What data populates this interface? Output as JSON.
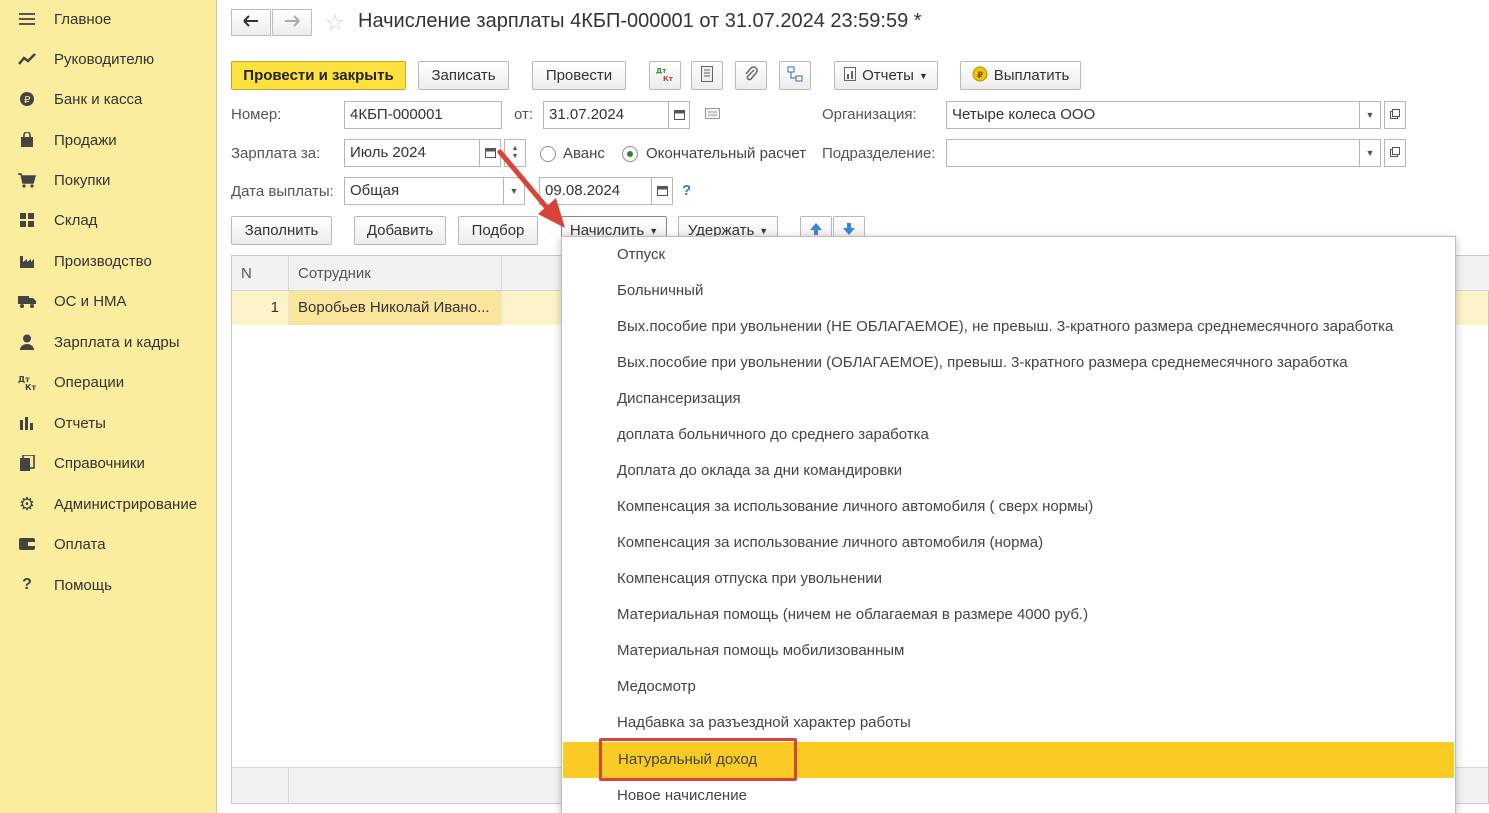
{
  "sidebar": {
    "items": [
      {
        "label": "Главное",
        "icon": "menu-icon"
      },
      {
        "label": "Руководителю",
        "icon": "trend-icon"
      },
      {
        "label": "Банк и касса",
        "icon": "coin-icon"
      },
      {
        "label": "Продажи",
        "icon": "bag-icon"
      },
      {
        "label": "Покупки",
        "icon": "cart-icon"
      },
      {
        "label": "Склад",
        "icon": "warehouse-icon"
      },
      {
        "label": "Производство",
        "icon": "factory-icon"
      },
      {
        "label": "ОС и НМА",
        "icon": "truck-icon"
      },
      {
        "label": "Зарплата и кадры",
        "icon": "person-icon"
      },
      {
        "label": "Операции",
        "icon": "dt-kt-icon"
      },
      {
        "label": "Отчеты",
        "icon": "bar-chart-icon"
      },
      {
        "label": "Справочники",
        "icon": "books-icon"
      },
      {
        "label": "Администрирование",
        "icon": "gear-icon"
      },
      {
        "label": "Оплата",
        "icon": "wallet-icon"
      },
      {
        "label": "Помощь",
        "icon": "question-icon"
      }
    ]
  },
  "header": {
    "title": "Начисление зарплаты 4КБП-000001 от 31.07.2024 23:59:59 *"
  },
  "toolbar": {
    "post_close": "Провести и закрыть",
    "save": "Записать",
    "post": "Провести",
    "dtkt_glyph": "Дт Кт",
    "reports": "Отчеты",
    "pay": "Выплатить"
  },
  "form": {
    "number_label": "Номер:",
    "number_value": "4КБП-000001",
    "from_label": "от:",
    "from_value": "31.07.2024",
    "org_label": "Организация:",
    "org_value": "Четыре колеса ООО",
    "salary_for_label": "Зарплата за:",
    "salary_for_value": "Июль 2024",
    "advance_label": "Аванс",
    "final_label": "Окончательный расчет",
    "dept_label": "Подразделение:",
    "dept_value": "",
    "pay_date_label": "Дата выплаты:",
    "pay_date_mode": "Общая",
    "pay_date_value": "09.08.2024",
    "help_mark": "?"
  },
  "table_toolbar": {
    "fill": "Заполнить",
    "add": "Добавить",
    "pick": "Подбор",
    "accrue": "Начислить",
    "withhold": "Удержать"
  },
  "table": {
    "columns": [
      "N",
      "Сотрудник"
    ],
    "rows": [
      {
        "n": "1",
        "employee": "Воробьев Николай Ивано..."
      }
    ]
  },
  "dropdown": {
    "items": [
      "Отпуск",
      "Больничный",
      "Вых.пособие при увольнении (НЕ ОБЛАГАЕМОЕ), не превыш. 3-кратного размера среднемесячного заработка",
      "Вых.пособие при увольнении (ОБЛАГАЕМОЕ), превыш. 3-кратного размера среднемесячного заработка",
      "Диспансеризация",
      "доплата больничного до среднего заработка",
      "Доплата до оклада за дни командировки",
      "Компенсация за использование личного автомобиля ( сверх нормы)",
      "Компенсация за использование личного автомобиля (норма)",
      "Компенсация отпуска при увольнении",
      "Материальная помощь (ничем не облагаемая в размере 4000 руб.)",
      "Материальная помощь мобилизованным",
      "Медосмотр",
      "Надбавка за разъездной характер работы",
      "Натуральный доход",
      "Новое начисление"
    ],
    "selected_index": 14
  },
  "colors": {
    "sidebar_bg": "#fbed9e",
    "primary_button": "#fde13e",
    "selected_row": "#f9cb24",
    "annotation_red": "#d9443a"
  }
}
